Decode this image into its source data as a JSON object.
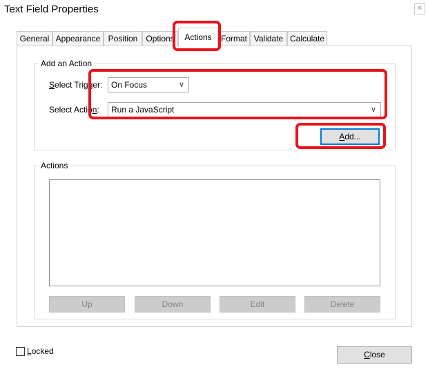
{
  "window": {
    "title": "Text Field Properties",
    "close_glyph": "✕"
  },
  "tabs": [
    {
      "label": "General"
    },
    {
      "label": "Appearance"
    },
    {
      "label": "Position"
    },
    {
      "label": "Options"
    },
    {
      "label": "Actions",
      "active": true
    },
    {
      "label": "Format"
    },
    {
      "label": "Validate"
    },
    {
      "label": "Calculate"
    }
  ],
  "add_action": {
    "group_label": "Add an Action",
    "trigger_label": "Select Trigger:",
    "trigger_value": "On Focus",
    "action_label": "Select Action:",
    "action_value": "Run a JavaScript",
    "add_button": "Add..."
  },
  "actions": {
    "group_label": "Actions",
    "buttons": {
      "up": "Up",
      "down": "Down",
      "edit": "Edit",
      "delete": "Delete"
    }
  },
  "footer": {
    "locked_label": "Locked",
    "locked_checked": false,
    "close_button": "Close"
  },
  "colors": {
    "highlight": "#e8131d",
    "focus_border": "#0078d7"
  }
}
